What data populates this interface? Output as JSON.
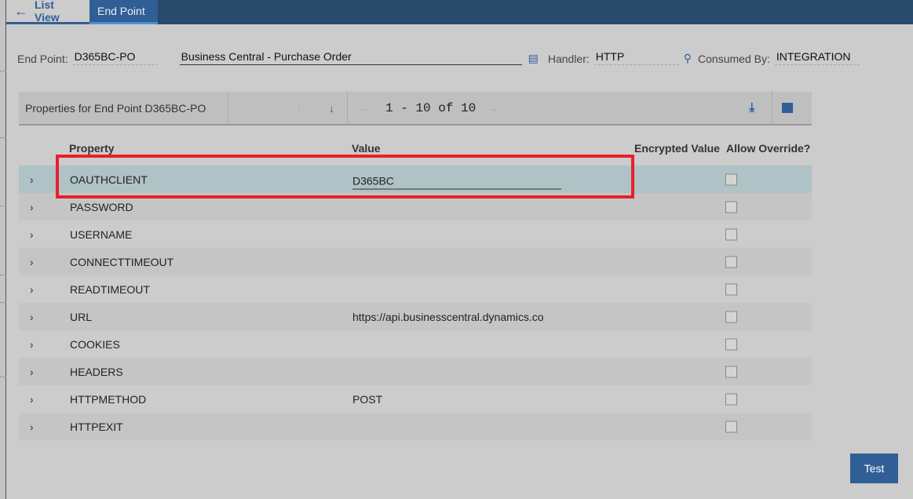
{
  "nav": {
    "back_label": "List View",
    "active_tab": "End Point"
  },
  "header": {
    "endpoint_label": "End Point:",
    "endpoint_value": "D365BC-PO",
    "description": "Business Central - Purchase Order",
    "handler_label": "Handler:",
    "handler_value": "HTTP",
    "consumed_label": "Consumed By:",
    "consumed_value": "INTEGRATION"
  },
  "toolbar": {
    "title": "Properties for End Point D365BC-PO",
    "pagination": "1 - 10 of 10"
  },
  "columns": {
    "property": "Property",
    "value": "Value",
    "encrypted": "Encrypted Value",
    "override": "Allow Override?"
  },
  "rows": [
    {
      "property": "OAUTHCLIENT",
      "value": "D365BC"
    },
    {
      "property": "PASSWORD",
      "value": ""
    },
    {
      "property": "USERNAME",
      "value": ""
    },
    {
      "property": "CONNECTTIMEOUT",
      "value": ""
    },
    {
      "property": "READTIMEOUT",
      "value": ""
    },
    {
      "property": "URL",
      "value": "https://api.businesscentral.dynamics.co"
    },
    {
      "property": "COOKIES",
      "value": ""
    },
    {
      "property": "HEADERS",
      "value": ""
    },
    {
      "property": "HTTPMETHOD",
      "value": "POST"
    },
    {
      "property": "HTTPEXIT",
      "value": ""
    }
  ],
  "test_label": "Test"
}
